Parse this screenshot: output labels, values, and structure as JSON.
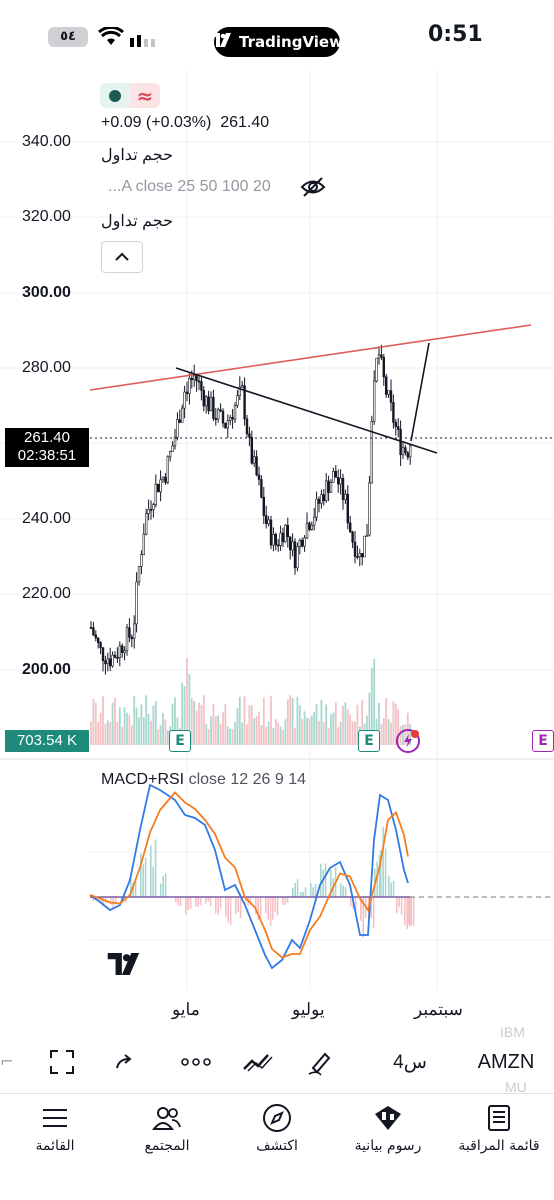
{
  "status_bar": {
    "time": "0:51",
    "battery": "٥٤"
  },
  "brand": {
    "name": "TradingView"
  },
  "legend": {
    "change": "+0.09 (+0.03%)",
    "last_price": "261.40",
    "volume_label_1": "حجم تداول",
    "indicator_text": "...A close 25 50 100 20",
    "volume_label_2": "حجم تداول"
  },
  "price_axis": {
    "ticks": [
      "340.00",
      "320.00",
      "300.00",
      "280.00",
      "240.00",
      "220.00",
      "200.00"
    ]
  },
  "current_price": {
    "price": "261.40",
    "countdown": "02:38:51"
  },
  "volume": {
    "value": "703.54 K"
  },
  "earnings_badge": "E",
  "macd_legend": {
    "name": "MACD+RSI",
    "params": "close 12 26 9 14"
  },
  "time_axis": {
    "labels": [
      "مايو",
      "يوليو",
      "سبتمبر"
    ]
  },
  "toolbar": {
    "symbol": "AMZN",
    "interval": "4س",
    "watermark_top": "IBM",
    "watermark_bottom": "MU"
  },
  "bottom_nav": {
    "items": [
      {
        "label": "القائمة",
        "icon": "menu-icon"
      },
      {
        "label": "المجتمع",
        "icon": "community-icon"
      },
      {
        "label": "اكتشف",
        "icon": "compass-icon"
      },
      {
        "label": "رسوم بيانية",
        "icon": "candles-icon"
      },
      {
        "label": "قائمة المراقبة",
        "icon": "watchlist-icon"
      }
    ]
  },
  "colors": {
    "up": "#131722",
    "down": "#131722",
    "teal": "#1d8a7a",
    "macd_line": "#2f7ae5",
    "signal_line": "#f57c1f",
    "resistance_line": "#e05c5c"
  }
}
